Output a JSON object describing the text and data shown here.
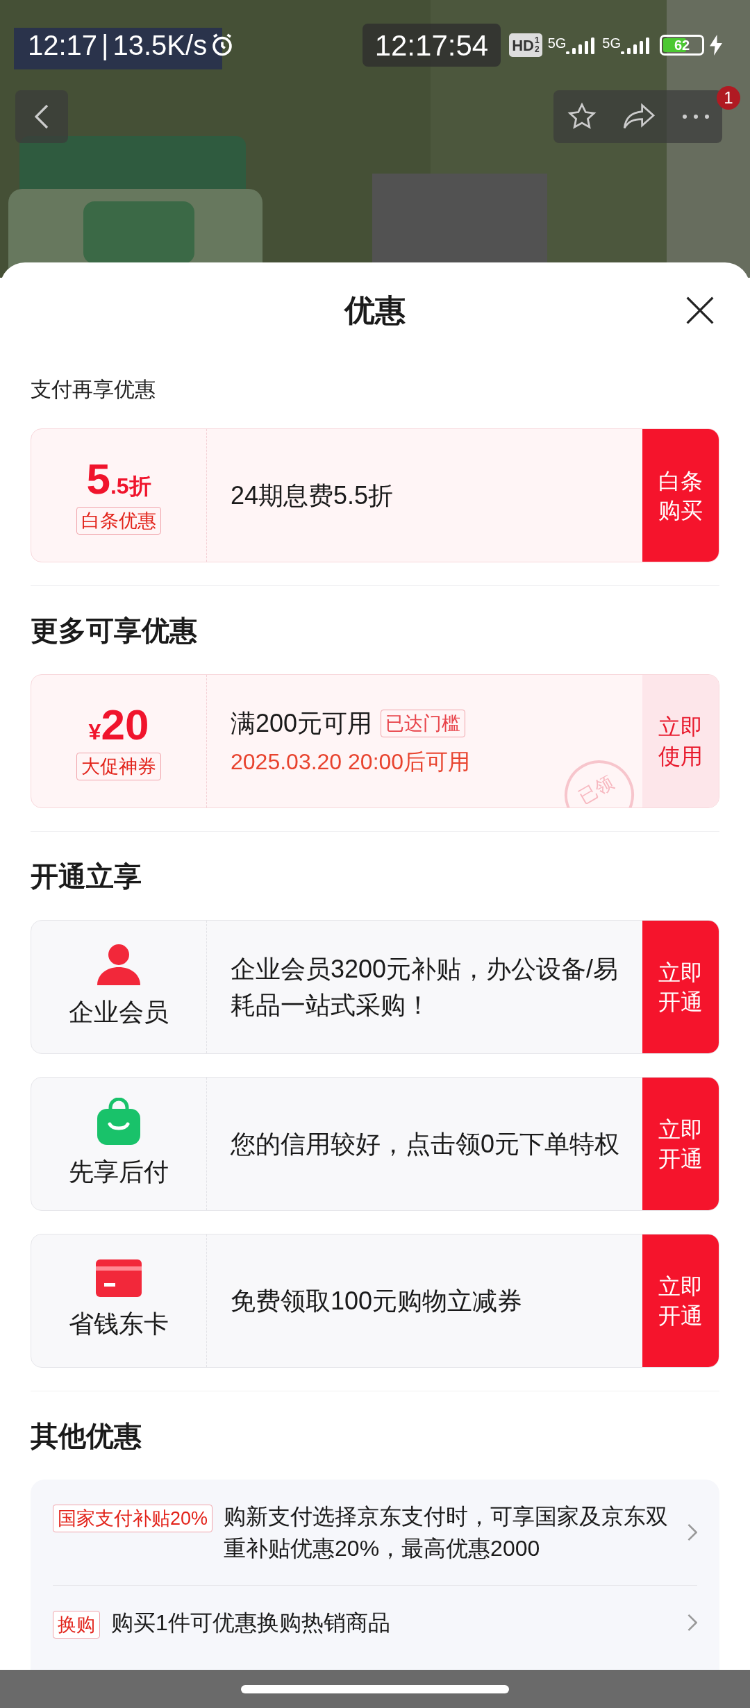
{
  "status_bar": {
    "time": "12:17",
    "divider": "|",
    "speed": "13.5K/s",
    "clock": "12:17:54",
    "hd": "HD",
    "hd_sims": [
      "1",
      "2"
    ],
    "networks": [
      "5G",
      "5G"
    ],
    "battery": "62"
  },
  "top_nav": {
    "badge": "1"
  },
  "sheet": {
    "title": "优惠"
  },
  "sections": [
    {
      "kind": "subtle",
      "heading": "支付再享优惠",
      "cards": [
        {
          "kind": "discount",
          "big": "5",
          "small": ".5折",
          "tag": "白条优惠",
          "text": "24期息费5.5折",
          "claimed": false,
          "action": [
            "白条",
            "购买"
          ]
        }
      ]
    },
    {
      "kind": "bold",
      "heading": "更多可享优惠",
      "cards": [
        {
          "kind": "coupon",
          "currency": "¥",
          "big": "20",
          "tag": "大促神券",
          "text": "满200元可用",
          "badge": "已达门槛",
          "note": "2025.03.20 20:00后可用",
          "stamp": "已领",
          "claimed": true,
          "action": [
            "立即",
            "使用"
          ]
        }
      ]
    },
    {
      "kind": "bold",
      "heading": "开通立享",
      "cards": [
        {
          "kind": "service",
          "label": "企业会员",
          "text": "企业会员3200元补贴，办公设备/易耗品一站式采购！",
          "claimed": false,
          "action": [
            "立即",
            "开通"
          ]
        },
        {
          "kind": "service",
          "label": "先享后付",
          "text": "您的信用较好，点击领0元下单特权",
          "claimed": false,
          "action": [
            "立即",
            "开通"
          ]
        },
        {
          "kind": "service",
          "label": "省钱东卡",
          "text": "免费领取100元购物立减券",
          "claimed": false,
          "action": [
            "立即",
            "开通"
          ]
        }
      ]
    },
    {
      "kind": "list",
      "heading": "其他优惠",
      "items": [
        {
          "tag": "国家支付补贴20%",
          "text": "购新支付选择京东支付时，可享国家及京东双重补贴优惠20%，最高优惠2000"
        },
        {
          "tag": "换购",
          "text": "购买1件可优惠换购热销商品"
        }
      ]
    }
  ]
}
